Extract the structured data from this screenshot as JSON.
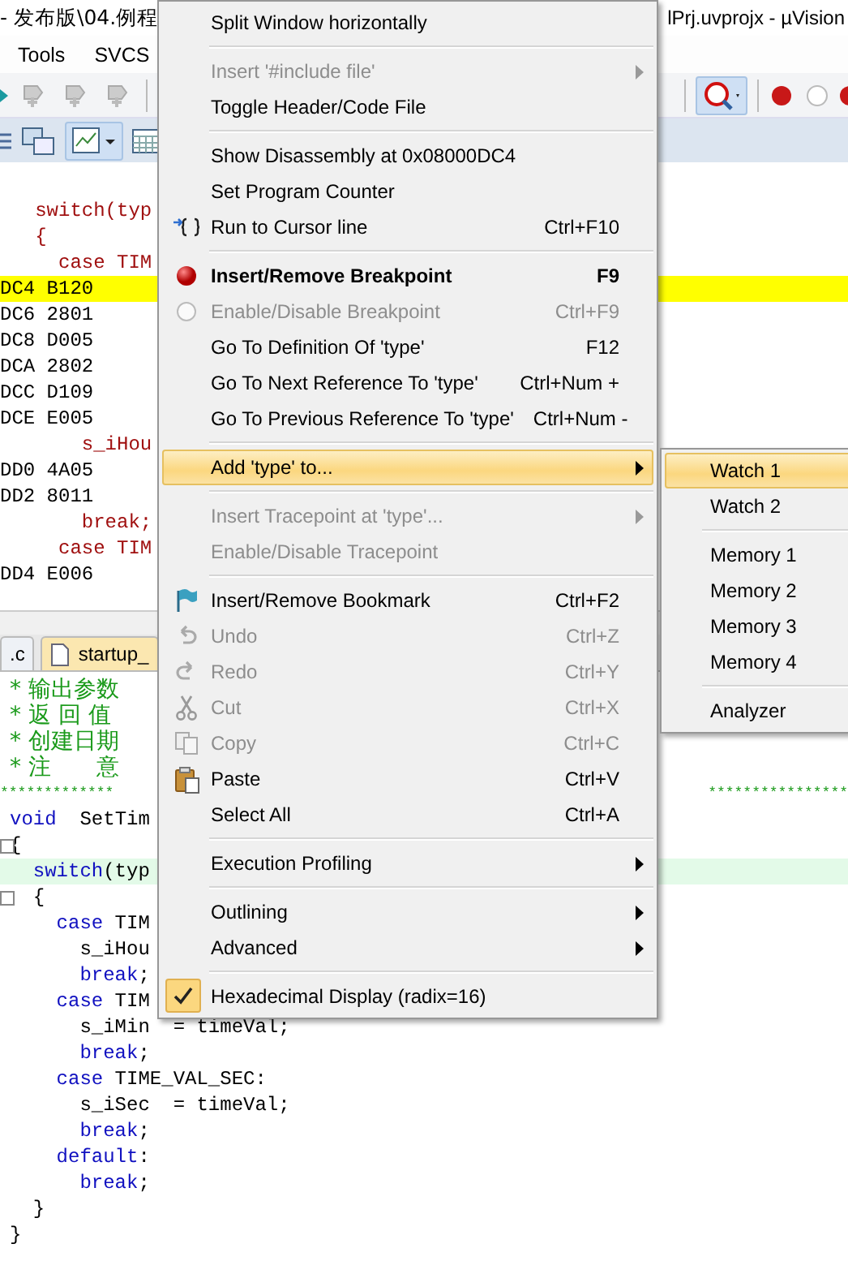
{
  "window": {
    "title_left": "- 发布版\\04.例程",
    "title_right": "lPrj.uvprojx - µVision"
  },
  "menubar": [
    "Tools",
    "SVCS"
  ],
  "disassembly": [
    {
      "kind": "source",
      "text": "   switch(typ",
      "current": false
    },
    {
      "kind": "source",
      "text": "   {",
      "current": false
    },
    {
      "kind": "source",
      "text": "     case TIM",
      "current": false
    },
    {
      "kind": "address",
      "text": "DC4 B120",
      "current": true
    },
    {
      "kind": "address",
      "text": "DC6 2801",
      "current": false
    },
    {
      "kind": "address",
      "text": "DC8 D005",
      "current": false
    },
    {
      "kind": "address",
      "text": "DCA 2802",
      "current": false
    },
    {
      "kind": "address",
      "text": "DCC D109",
      "current": false
    },
    {
      "kind": "address",
      "text": "DCE E005",
      "current": false
    },
    {
      "kind": "source",
      "text": "       s_iHou",
      "current": false
    },
    {
      "kind": "address",
      "text": "DD0 4A05",
      "current": false
    },
    {
      "kind": "address",
      "text": "DD2 8011",
      "current": false
    },
    {
      "kind": "source",
      "text": "       break;",
      "current": false
    },
    {
      "kind": "source",
      "text": "     case TIM",
      "current": false
    },
    {
      "kind": "address",
      "text": "DD4 E006",
      "current": false
    }
  ],
  "tabs": [
    {
      "label": ".c",
      "selected": false
    },
    {
      "label": "startup_",
      "selected": true
    }
  ],
  "editor": [
    {
      "kind": "code",
      "current": false,
      "fold": false,
      "tokens": [
        {
          "kind": "comment",
          "text": "* 输出参数"
        }
      ]
    },
    {
      "kind": "code",
      "current": false,
      "fold": false,
      "tokens": [
        {
          "kind": "comment",
          "text": "* 返 回 值"
        }
      ]
    },
    {
      "kind": "code",
      "current": false,
      "fold": false,
      "tokens": [
        {
          "kind": "comment",
          "text": "* 创建日期"
        }
      ]
    },
    {
      "kind": "code",
      "current": false,
      "fold": false,
      "tokens": [
        {
          "kind": "comment",
          "text": "* 注　　意"
        }
      ]
    },
    {
      "kind": "stars",
      "left": "*************",
      "right": "****************"
    },
    {
      "kind": "code",
      "current": false,
      "fold": false,
      "tokens": [
        {
          "kind": "keyword",
          "text": "void"
        },
        {
          "kind": "plain",
          "text": "  SetTim"
        }
      ]
    },
    {
      "kind": "code",
      "current": false,
      "fold": true,
      "tokens": [
        {
          "kind": "plain",
          "text": "{"
        }
      ]
    },
    {
      "kind": "code",
      "current": true,
      "fold": false,
      "tokens": [
        {
          "kind": "keyword",
          "text": "  switch"
        },
        {
          "kind": "plain",
          "text": "(typ"
        }
      ]
    },
    {
      "kind": "code",
      "current": false,
      "fold": true,
      "tokens": [
        {
          "kind": "plain",
          "text": "  {"
        }
      ]
    },
    {
      "kind": "code",
      "current": false,
      "fold": false,
      "tokens": [
        {
          "kind": "keyword",
          "text": "    case"
        },
        {
          "kind": "plain",
          "text": " TIM"
        }
      ]
    },
    {
      "kind": "code",
      "current": false,
      "fold": false,
      "tokens": [
        {
          "kind": "plain",
          "text": "      s_iHou"
        }
      ]
    },
    {
      "kind": "code",
      "current": false,
      "fold": false,
      "tokens": [
        {
          "kind": "keyword",
          "text": "      break"
        },
        {
          "kind": "plain",
          "text": ";"
        }
      ]
    },
    {
      "kind": "code",
      "current": false,
      "fold": false,
      "tokens": [
        {
          "kind": "keyword",
          "text": "    case"
        },
        {
          "kind": "plain",
          "text": " TIM"
        }
      ]
    },
    {
      "kind": "code",
      "current": false,
      "fold": false,
      "tokens": [
        {
          "kind": "plain",
          "text": "      s_iMin  = timeVal;"
        }
      ]
    },
    {
      "kind": "code",
      "current": false,
      "fold": false,
      "tokens": [
        {
          "kind": "keyword",
          "text": "      break"
        },
        {
          "kind": "plain",
          "text": ";"
        }
      ]
    },
    {
      "kind": "code",
      "current": false,
      "fold": false,
      "tokens": [
        {
          "kind": "keyword",
          "text": "    case"
        },
        {
          "kind": "plain",
          "text": " TIME_VAL_SEC:"
        }
      ]
    },
    {
      "kind": "code",
      "current": false,
      "fold": false,
      "tokens": [
        {
          "kind": "plain",
          "text": "      s_iSec  = timeVal;"
        }
      ]
    },
    {
      "kind": "code",
      "current": false,
      "fold": false,
      "tokens": [
        {
          "kind": "keyword",
          "text": "      break"
        },
        {
          "kind": "plain",
          "text": ";"
        }
      ]
    },
    {
      "kind": "code",
      "current": false,
      "fold": false,
      "tokens": [
        {
          "kind": "keyword",
          "text": "    default"
        },
        {
          "kind": "plain",
          "text": ":"
        }
      ]
    },
    {
      "kind": "code",
      "current": false,
      "fold": false,
      "tokens": [
        {
          "kind": "keyword",
          "text": "      break"
        },
        {
          "kind": "plain",
          "text": ";"
        }
      ]
    },
    {
      "kind": "code",
      "current": false,
      "fold": false,
      "tokens": [
        {
          "kind": "plain",
          "text": "  }"
        }
      ]
    },
    {
      "kind": "code",
      "current": false,
      "fold": false,
      "tokens": [
        {
          "kind": "plain",
          "text": "}"
        }
      ]
    }
  ],
  "context_menu": [
    {
      "kind": "item",
      "label": "Split Window horizontally",
      "disabled": false,
      "selected": false,
      "checked": false,
      "submenu": false
    },
    {
      "kind": "separator"
    },
    {
      "kind": "item",
      "label": "Insert '#include file'",
      "disabled": true,
      "selected": false,
      "checked": false,
      "submenu": true
    },
    {
      "kind": "item",
      "label": "Toggle Header/Code File",
      "disabled": false,
      "selected": false,
      "checked": false,
      "submenu": false
    },
    {
      "kind": "separator"
    },
    {
      "kind": "item",
      "label": "Show Disassembly at 0x08000DC4",
      "disabled": false,
      "selected": false,
      "checked": false,
      "submenu": false
    },
    {
      "kind": "item",
      "label": "Set Program Counter",
      "disabled": false,
      "selected": false,
      "checked": false,
      "submenu": false
    },
    {
      "kind": "item",
      "label": "Run to Cursor line",
      "shortcut": "Ctrl+F10",
      "disabled": false,
      "selected": false,
      "checked": false,
      "submenu": false
    },
    {
      "kind": "separator"
    },
    {
      "kind": "item",
      "label": "Insert/Remove Breakpoint",
      "shortcut": "F9",
      "bold": true,
      "disabled": false,
      "selected": false,
      "checked": false,
      "submenu": false
    },
    {
      "kind": "item",
      "label": "Enable/Disable Breakpoint",
      "shortcut": "Ctrl+F9",
      "disabled": true,
      "selected": false,
      "checked": false,
      "submenu": false
    },
    {
      "kind": "item",
      "label": "Go To Definition Of 'type'",
      "shortcut": "F12",
      "disabled": false,
      "selected": false,
      "checked": false,
      "submenu": false
    },
    {
      "kind": "item",
      "label": "Go To Next Reference To 'type'",
      "shortcut": "Ctrl+Num +",
      "disabled": false,
      "selected": false,
      "checked": false,
      "submenu": false
    },
    {
      "kind": "item",
      "label": "Go To Previous Reference To 'type'",
      "shortcut": "Ctrl+Num -",
      "disabled": false,
      "selected": false,
      "checked": false,
      "submenu": false
    },
    {
      "kind": "separator"
    },
    {
      "kind": "item",
      "label": "Add 'type' to...",
      "disabled": false,
      "selected": true,
      "checked": false,
      "submenu": true
    },
    {
      "kind": "separator"
    },
    {
      "kind": "item",
      "label": "Insert Tracepoint at 'type'...",
      "disabled": true,
      "selected": false,
      "checked": false,
      "submenu": true
    },
    {
      "kind": "item",
      "label": "Enable/Disable Tracepoint",
      "disabled": true,
      "selected": false,
      "checked": false,
      "submenu": false
    },
    {
      "kind": "separator"
    },
    {
      "kind": "item",
      "label": "Insert/Remove Bookmark",
      "shortcut": "Ctrl+F2",
      "disabled": false,
      "selected": false,
      "checked": false,
      "submenu": false
    },
    {
      "kind": "item",
      "label": "Undo",
      "shortcut": "Ctrl+Z",
      "disabled": true,
      "selected": false,
      "checked": false,
      "submenu": false
    },
    {
      "kind": "item",
      "label": "Redo",
      "shortcut": "Ctrl+Y",
      "disabled": true,
      "selected": false,
      "checked": false,
      "submenu": false
    },
    {
      "kind": "item",
      "label": "Cut",
      "shortcut": "Ctrl+X",
      "disabled": true,
      "selected": false,
      "checked": false,
      "submenu": false
    },
    {
      "kind": "item",
      "label": "Copy",
      "shortcut": "Ctrl+C",
      "disabled": true,
      "selected": false,
      "checked": false,
      "submenu": false
    },
    {
      "kind": "item",
      "label": "Paste",
      "shortcut": "Ctrl+V",
      "disabled": false,
      "selected": false,
      "checked": false,
      "submenu": false
    },
    {
      "kind": "item",
      "label": "Select All",
      "shortcut": "Ctrl+A",
      "disabled": false,
      "selected": false,
      "checked": false,
      "submenu": false
    },
    {
      "kind": "separator"
    },
    {
      "kind": "item",
      "label": "Execution Profiling",
      "disabled": false,
      "selected": false,
      "checked": false,
      "submenu": true
    },
    {
      "kind": "separator"
    },
    {
      "kind": "item",
      "label": "Outlining",
      "disabled": false,
      "selected": false,
      "checked": false,
      "submenu": true
    },
    {
      "kind": "item",
      "label": "Advanced",
      "disabled": false,
      "selected": false,
      "checked": false,
      "submenu": true
    },
    {
      "kind": "separator"
    },
    {
      "kind": "item",
      "label": "Hexadecimal Display (radix=16)",
      "disabled": false,
      "selected": false,
      "checked": true,
      "submenu": false
    }
  ],
  "submenu": [
    {
      "kind": "item",
      "label": "Watch 1",
      "selected": true
    },
    {
      "kind": "item",
      "label": "Watch 2",
      "selected": false
    },
    {
      "kind": "separator"
    },
    {
      "kind": "item",
      "label": "Memory 1",
      "selected": false
    },
    {
      "kind": "item",
      "label": "Memory 2",
      "selected": false
    },
    {
      "kind": "item",
      "label": "Memory 3",
      "selected": false
    },
    {
      "kind": "item",
      "label": "Memory 4",
      "selected": false
    },
    {
      "kind": "separator"
    },
    {
      "kind": "item",
      "label": "Analyzer",
      "selected": false
    }
  ]
}
